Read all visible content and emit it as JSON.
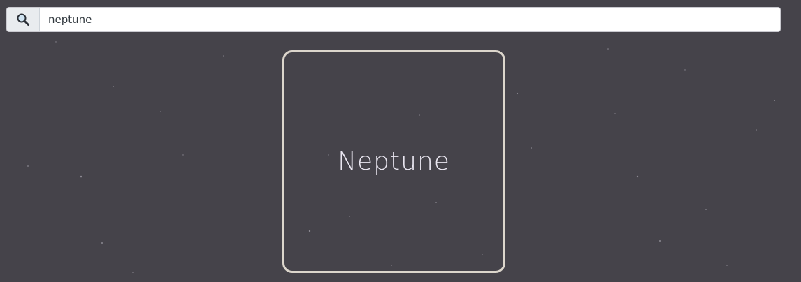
{
  "search": {
    "value": "neptune",
    "icon": "search-icon"
  },
  "results": [
    {
      "name": "Neptune"
    }
  ],
  "colors": {
    "background": "#45434a",
    "card_border": "#dcd6cc",
    "card_text": "#e9e6f0"
  }
}
